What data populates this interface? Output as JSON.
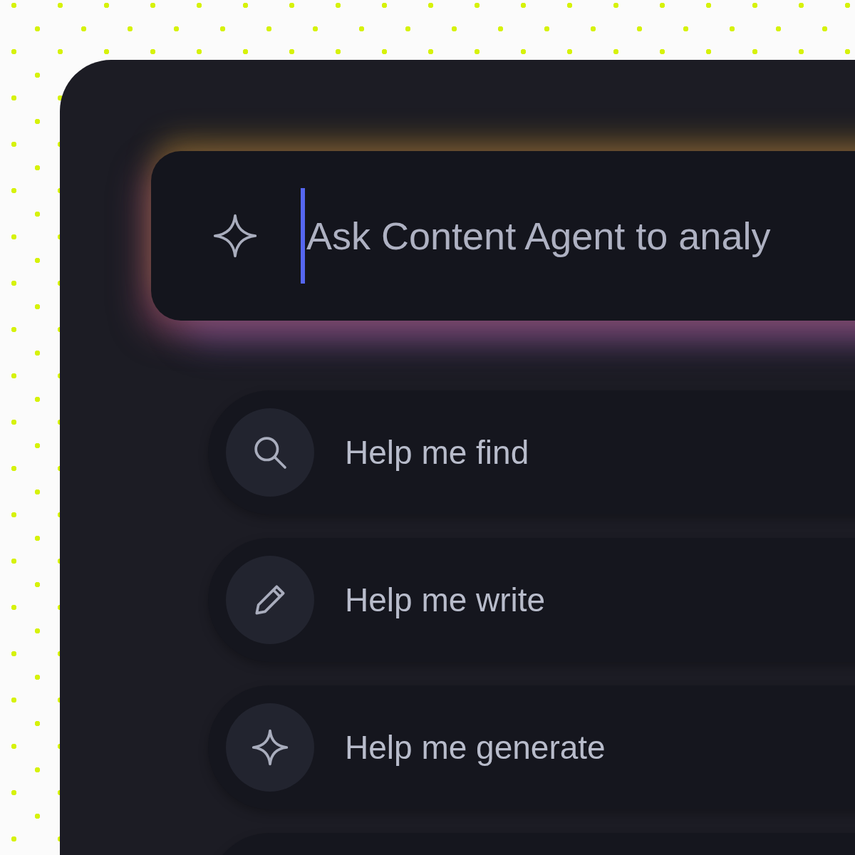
{
  "prompt": {
    "placeholder": "Ask Content Agent to analy"
  },
  "suggestions": [
    {
      "kind": "search",
      "label": "Help me find"
    },
    {
      "kind": "pencil",
      "label": "Help me write"
    },
    {
      "kind": "sparkle",
      "label": "Help me generate"
    }
  ]
}
